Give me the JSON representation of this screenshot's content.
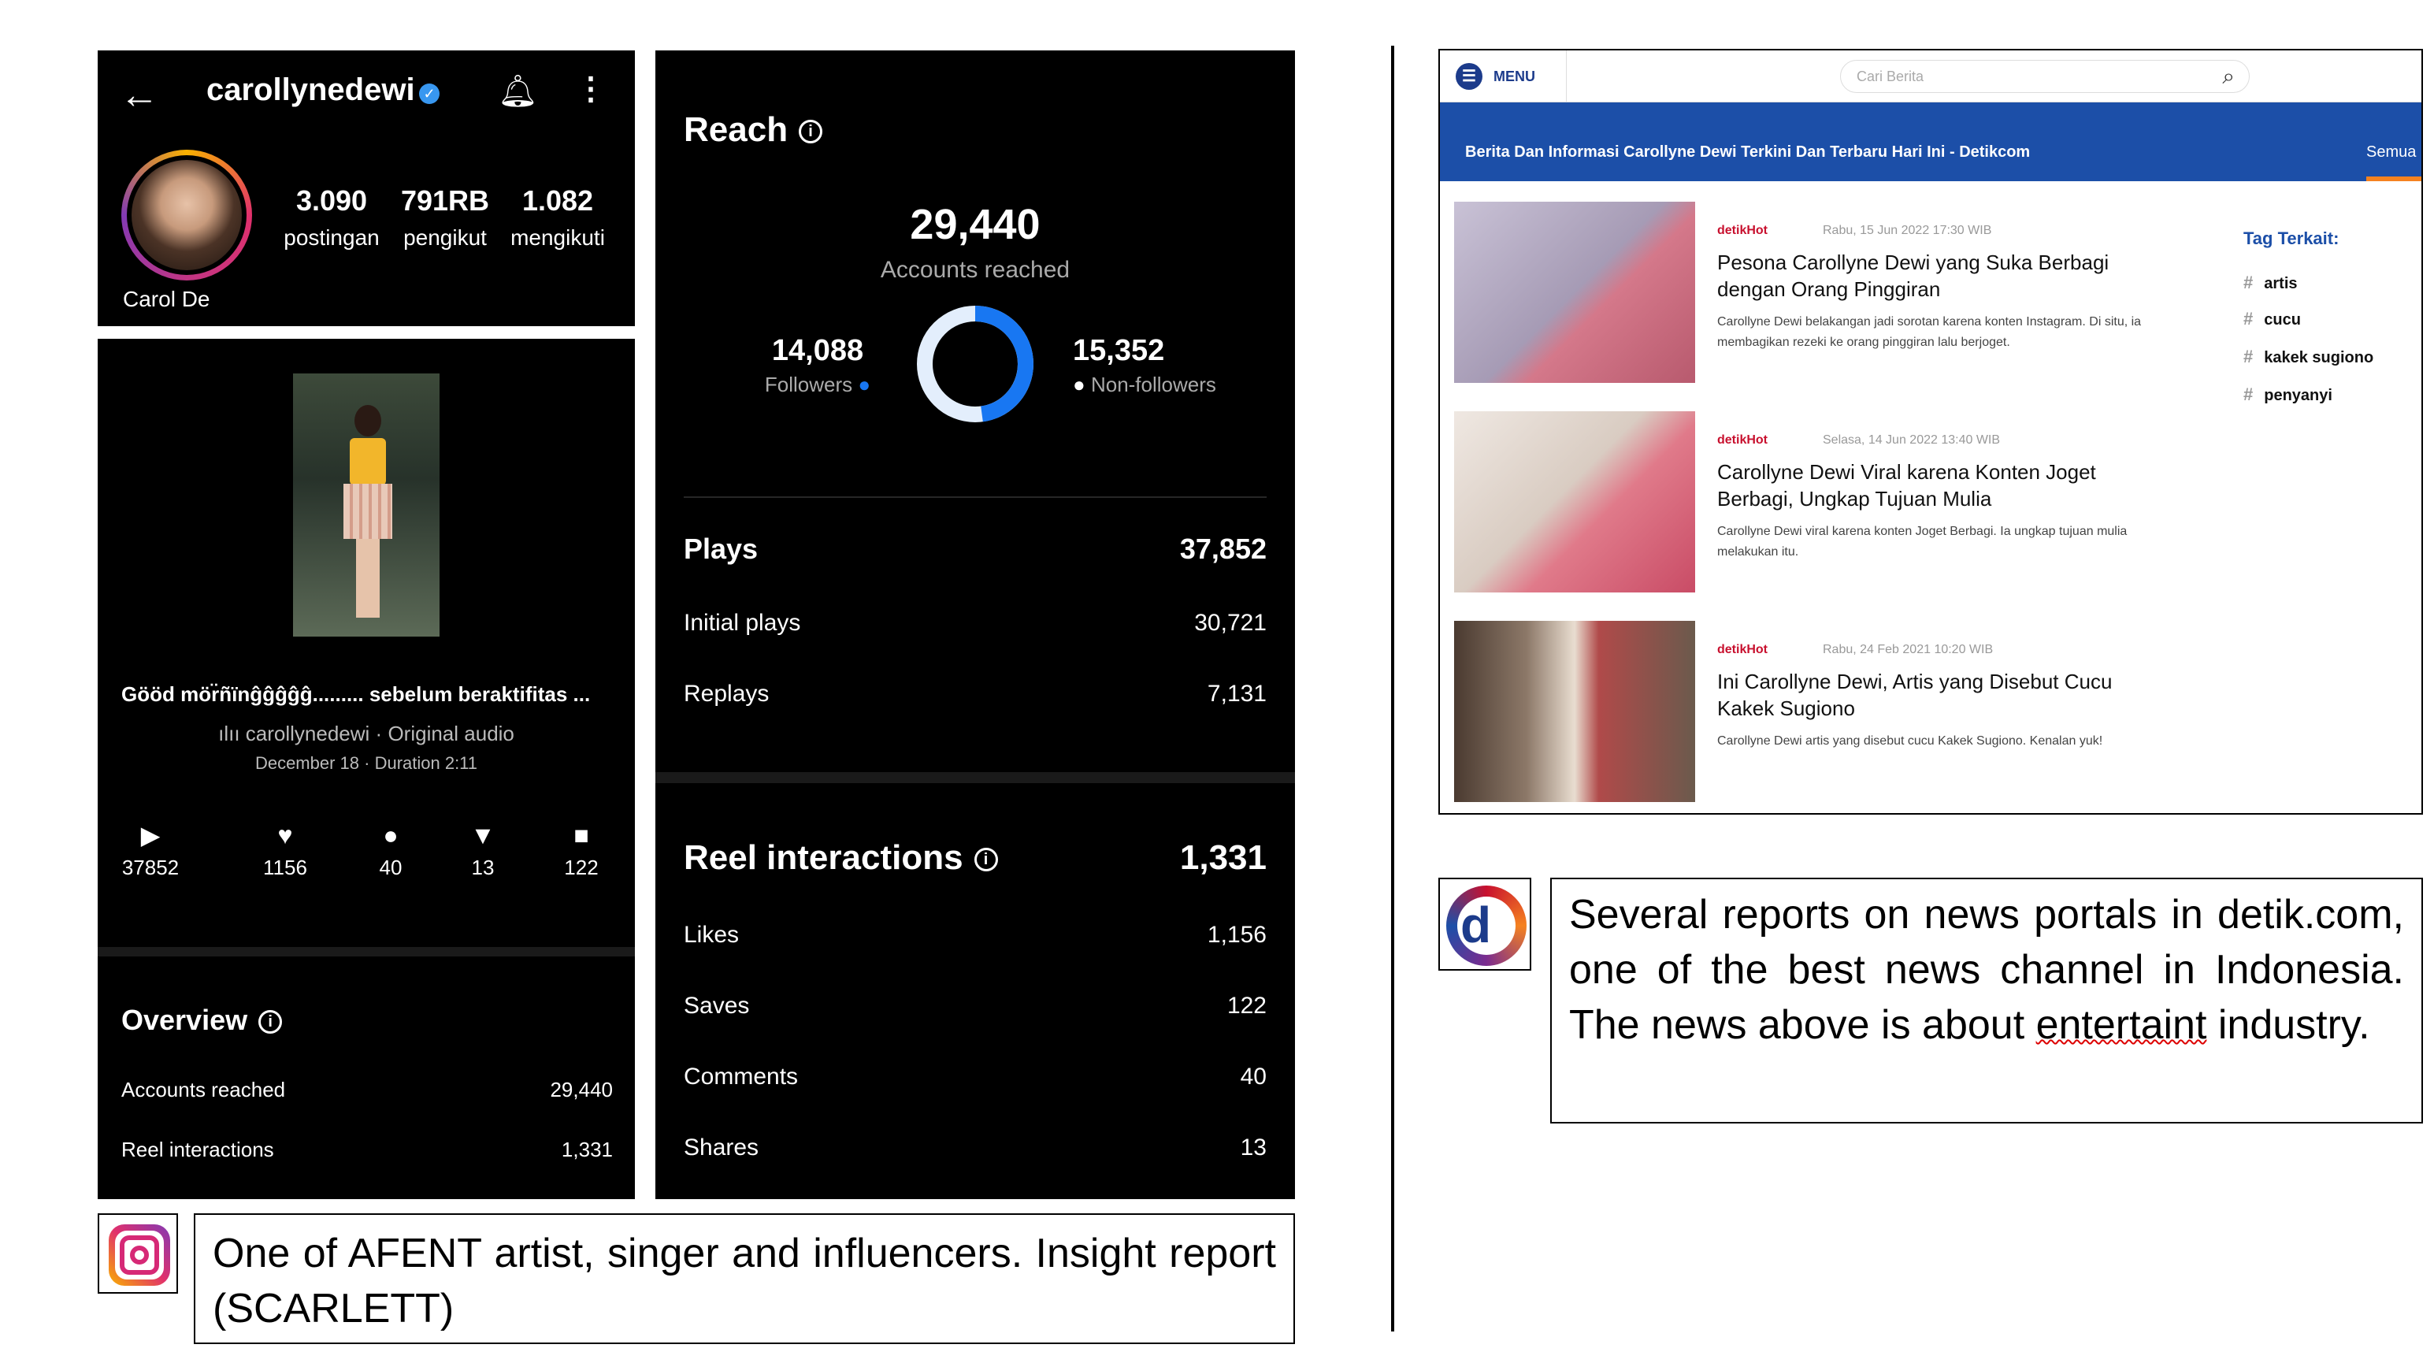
{
  "profile": {
    "username": "carollynedewi",
    "display_name": "Carol De",
    "stats": [
      {
        "value": "3.090",
        "label": "postingan"
      },
      {
        "value": "791RB",
        "label": "pengikut"
      },
      {
        "value": "1.082",
        "label": "mengikuti"
      }
    ]
  },
  "reel": {
    "caption": "Gö̈ö̈d mö̈r̈ñïnĝĝĝĝĝ......... sebelum beraktifitas ...",
    "audio_user": "carollynedewi",
    "audio_sep": "·",
    "audio_label": "Original audio",
    "date_line": "December 18 · Duration 2:11",
    "metrics": [
      {
        "icon": "play-icon",
        "glyph": "▶",
        "value": "37852"
      },
      {
        "icon": "heart-icon",
        "glyph": "♥",
        "value": "1156"
      },
      {
        "icon": "comment-icon",
        "glyph": "●",
        "value": "40"
      },
      {
        "icon": "share-icon",
        "glyph": "▼",
        "value": "13"
      },
      {
        "icon": "bookmark-icon",
        "glyph": "■",
        "value": "122"
      }
    ],
    "overview_title": "Overview",
    "overview_rows": [
      {
        "label": "Accounts reached",
        "value": "29,440"
      },
      {
        "label": "Reel interactions",
        "value": "1,331"
      }
    ]
  },
  "insights": {
    "reach_title": "Reach",
    "accounts_reached": "29,440",
    "accounts_reached_label": "Accounts reached",
    "followers_value": "14,088",
    "followers_label": "Followers",
    "nonfollowers_value": "15,352",
    "nonfollowers_label": "Non-followers",
    "followers_share": 0.4785,
    "plays_rows": [
      {
        "label": "Plays",
        "value": "37,852",
        "bold": true
      },
      {
        "label": "Initial plays",
        "value": "30,721"
      },
      {
        "label": "Replays",
        "value": "7,131"
      }
    ],
    "interactions_title": "Reel interactions",
    "interactions_value": "1,331",
    "interaction_rows": [
      {
        "label": "Likes",
        "value": "1,156"
      },
      {
        "label": "Saves",
        "value": "122"
      },
      {
        "label": "Comments",
        "value": "40"
      },
      {
        "label": "Shares",
        "value": "13"
      }
    ],
    "colors": {
      "followers": "#1877f2",
      "nonfollowers": "#e3eefc"
    }
  },
  "captions": {
    "instagram": "One of AFENT artist, singer and influencers. Insight report (SCARLETT)",
    "detik_part1": "Several reports on news portals in detik.com, one of the best news channel in Indonesia. The news above is about ",
    "detik_misspelled": "entertaint",
    "detik_part2": " industry."
  },
  "detik": {
    "menu_label": "MENU",
    "search_placeholder": "Cari Berita",
    "page_title": "Berita Dan Informasi Carollyne Dewi Terkini Dan Terbaru Hari Ini - Detikcom",
    "tab_label": "Semua",
    "articles": [
      {
        "source": "detikHot",
        "date": "Rabu, 15 Jun 2022 17:30 WIB",
        "title": "Pesona Carollyne Dewi yang Suka Berbagi dengan Orang Pinggiran",
        "desc": "Carollyne Dewi belakangan jadi sorotan karena konten Instagram. Di situ, ia membagikan rezeki ke orang pinggiran lalu berjoget."
      },
      {
        "source": "detikHot",
        "date": "Selasa, 14 Jun 2022 13:40 WIB",
        "title": "Carollyne Dewi Viral karena Konten Joget Berbagi, Ungkap Tujuan Mulia",
        "desc": "Carollyne Dewi viral karena konten Joget Berbagi. Ia ungkap tujuan mulia melakukan itu."
      },
      {
        "source": "detikHot",
        "date": "Rabu, 24 Feb 2021 10:20 WIB",
        "title": "Ini Carollyne Dewi, Artis yang Disebut Cucu Kakek Sugiono",
        "desc": "Carollyne Dewi artis yang disebut cucu Kakek Sugiono. Kenalan yuk!"
      }
    ],
    "tags_title": "Tag Terkait:",
    "tags": [
      "artis",
      "cucu",
      "kakek sugiono",
      "penyanyi"
    ]
  }
}
